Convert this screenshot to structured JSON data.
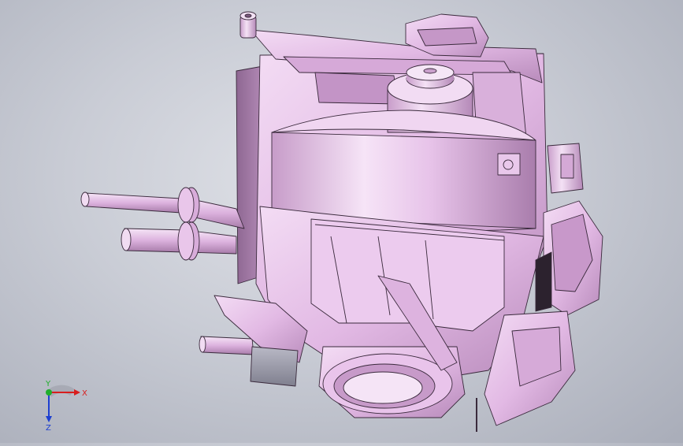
{
  "viewport": {
    "model": "hvac-blower-housing-assembly",
    "background_top": "#dfe1e7",
    "background_bottom": "#a9adb9",
    "part_color": "#e4bde6",
    "part_shadow": "#a47aa8",
    "part_highlight": "#f7e6f8",
    "edge_color": "#3a2a3c"
  },
  "triad": {
    "x_label": "X",
    "y_label": "Y",
    "z_label": "Z",
    "x_color": "#d81e1e",
    "y_color": "#1fae2c",
    "z_color": "#1d3fd1"
  }
}
